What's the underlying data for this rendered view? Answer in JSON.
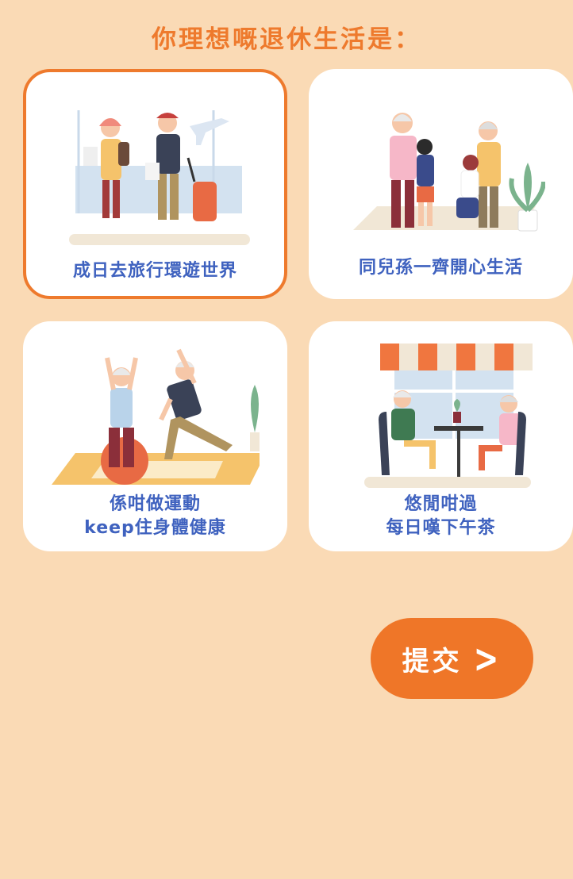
{
  "question": {
    "title": "你理想嘅退休生活是："
  },
  "options": [
    {
      "label": "成日去旅行環遊世界",
      "selected": true
    },
    {
      "label": "同兒孫一齊開心生活",
      "selected": false
    },
    {
      "label_line1": "係咁做運動",
      "label_line2": "keep住身體健康",
      "selected": false
    },
    {
      "label_line1": "悠閒咁過",
      "label_line2": "每日嘆下午茶",
      "selected": false
    }
  ],
  "submit": {
    "label": "提交",
    "icon": "chevron-right-icon"
  },
  "colors": {
    "background": "#FADAB5",
    "accent": "#EE7A2D",
    "label": "#3F62BF",
    "card": "#FFFFFF"
  }
}
